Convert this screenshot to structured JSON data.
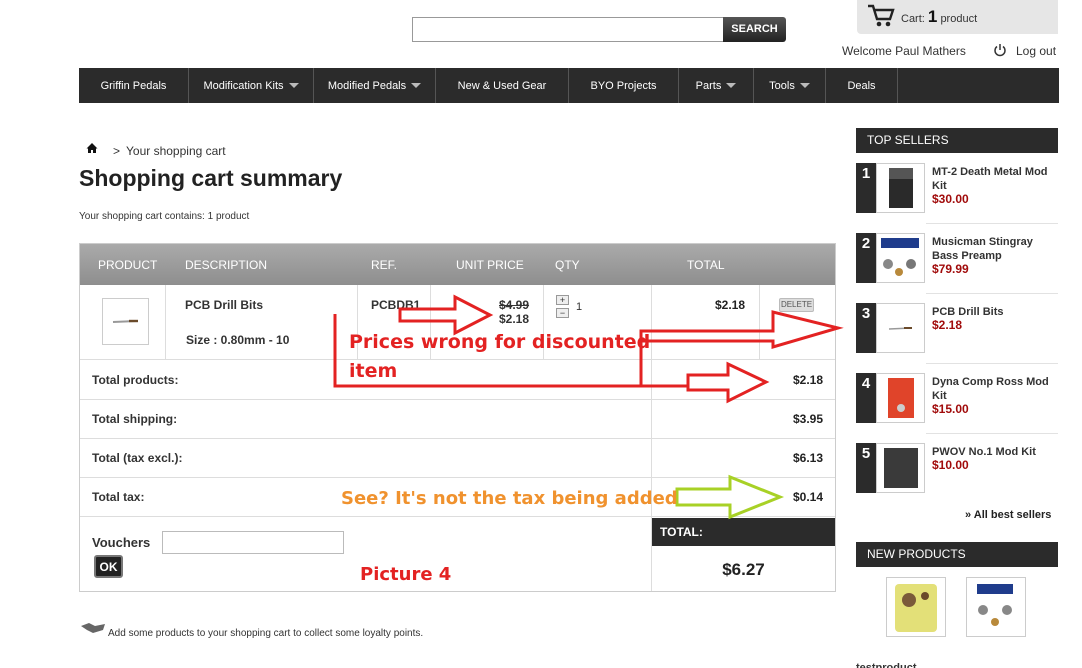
{
  "header": {
    "search_button": "SEARCH",
    "cart_label": "Cart:",
    "cart_count": "1",
    "cart_unit": "product",
    "welcome": "Welcome Paul Mathers",
    "logout": "Log out"
  },
  "nav": [
    {
      "label": "Griffin Pedals",
      "dropdown": false
    },
    {
      "label": "Modification Kits",
      "dropdown": true
    },
    {
      "label": "Modified Pedals",
      "dropdown": true
    },
    {
      "label": "New & Used Gear",
      "dropdown": false
    },
    {
      "label": "BYO Projects",
      "dropdown": false
    },
    {
      "label": "Parts",
      "dropdown": true
    },
    {
      "label": "Tools",
      "dropdown": true
    },
    {
      "label": "Deals",
      "dropdown": false
    }
  ],
  "breadcrumb": {
    "sep": ">",
    "current": "Your shopping cart"
  },
  "page_title": "Shopping cart summary",
  "cart_contains": "Your shopping cart contains: 1 product",
  "table": {
    "headers": {
      "product": "PRODUCT",
      "description": "DESCRIPTION",
      "ref": "REF.",
      "unit_price": "UNIT PRICE",
      "qty": "QTY",
      "total": "TOTAL"
    },
    "item": {
      "name": "PCB Drill Bits",
      "size": "Size : 0.80mm - 10",
      "ref": "PCBDB1",
      "old_price": "$4.99",
      "new_price": "$2.18",
      "qty": "1",
      "total": "$2.18",
      "delete": "DELETE"
    },
    "summary": {
      "total_products_label": "Total products:",
      "total_products": "$2.18",
      "total_shipping_label": "Total shipping:",
      "total_shipping": "$3.95",
      "total_tax_excl_label": "Total (tax excl.):",
      "total_tax_excl": "$6.13",
      "total_tax_label": "Total tax:",
      "total_tax": "$0.14",
      "total_label": "TOTAL:",
      "total": "$6.27"
    },
    "vouchers_label": "Vouchers",
    "ok_button": "OK"
  },
  "loyalty_text": "Add some products to your shopping cart to collect some loyalty points.",
  "annotations": {
    "prices_wrong": "Prices wrong for discounted item",
    "prices_wrong_line1": "Prices wrong for discounted",
    "prices_wrong_line2": "item",
    "tax_note": "See? It's not the tax being added",
    "picture": "Picture 4",
    "red": "#e32222",
    "green": "#a8d126",
    "orange": "#f0922e"
  },
  "sidebar": {
    "top_sellers_title": "TOP SELLERS",
    "top_sellers": [
      {
        "rank": "1",
        "name": "MT-2 Death Metal Mod Kit",
        "price": "$30.00"
      },
      {
        "rank": "2",
        "name": "Musicman Stingray Bass Preamp",
        "price": "$79.99"
      },
      {
        "rank": "3",
        "name": "PCB Drill Bits",
        "price": "$2.18"
      },
      {
        "rank": "4",
        "name": "Dyna Comp Ross Mod Kit",
        "price": "$15.00"
      },
      {
        "rank": "5",
        "name": "PWOV No.1 Mod Kit",
        "price": "$10.00"
      }
    ],
    "all_best_sellers": "» All best sellers",
    "new_products_title": "NEW PRODUCTS",
    "new_product_label": "testproduct"
  },
  "colors": {
    "dark": "#2b2b2b",
    "price_red": "#a10b0b",
    "header_gray": "#999999"
  }
}
